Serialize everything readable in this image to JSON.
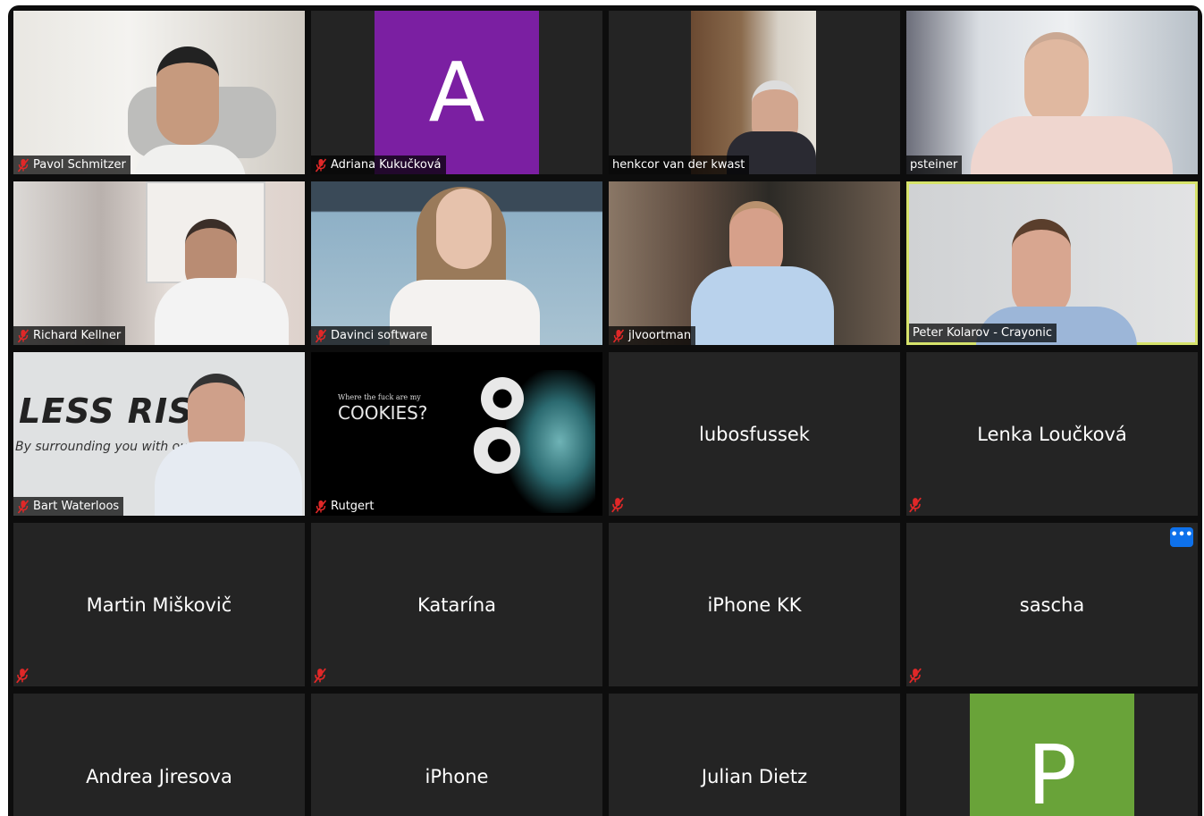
{
  "colors": {
    "background": "#0d0d0d",
    "tile": "#242424",
    "active_speaker_border": "#d6e36b",
    "mute_icon": "#e02828",
    "avatar_purple": "#7b1fa2",
    "avatar_green": "#69a339",
    "more_button": "#0e71eb"
  },
  "participants": [
    {
      "name": "Pavol Schmitzer",
      "video": true,
      "muted": true
    },
    {
      "name": "Adriana Kukučková",
      "video": false,
      "avatar_letter": "A",
      "muted": true
    },
    {
      "name": "henkcor van der kwast",
      "video": true,
      "muted": false
    },
    {
      "name": "psteiner",
      "video": true,
      "muted": false
    },
    {
      "name": "Richard Kellner",
      "video": true,
      "muted": true
    },
    {
      "name": "Davinci software",
      "video": true,
      "muted": true
    },
    {
      "name": "jlvoortman",
      "video": true,
      "muted": true
    },
    {
      "name": "Peter Kolarov - Crayonic",
      "video": true,
      "muted": false,
      "active_speaker": true
    },
    {
      "name": "Bart Waterloos",
      "video": true,
      "muted": true,
      "background_text_1": "LESS RIS S",
      "background_text_2": "By surrounding you with our alists"
    },
    {
      "name": "Rutgert",
      "video": true,
      "muted": true,
      "background_text_small": "Where the fuck are my",
      "background_text_big": "COOKIES?"
    },
    {
      "name": "lubosfussek",
      "video": false,
      "muted": true
    },
    {
      "name": "Lenka Loučková",
      "video": false,
      "muted": true
    },
    {
      "name": "Martin Miškovič",
      "video": false,
      "muted": true
    },
    {
      "name": "Katarína",
      "video": false,
      "muted": true
    },
    {
      "name": "iPhone KK",
      "video": false,
      "muted": false
    },
    {
      "name": "sascha",
      "video": false,
      "muted": true,
      "more_button_label": "•••"
    },
    {
      "name": "Andrea Jiresova",
      "video": false,
      "muted": false
    },
    {
      "name": "iPhone",
      "video": false,
      "muted": false
    },
    {
      "name": "Julian Dietz",
      "video": false,
      "muted": false
    },
    {
      "name": "P",
      "video": false,
      "avatar_letter": "P",
      "muted": false,
      "name_hidden": true
    }
  ]
}
